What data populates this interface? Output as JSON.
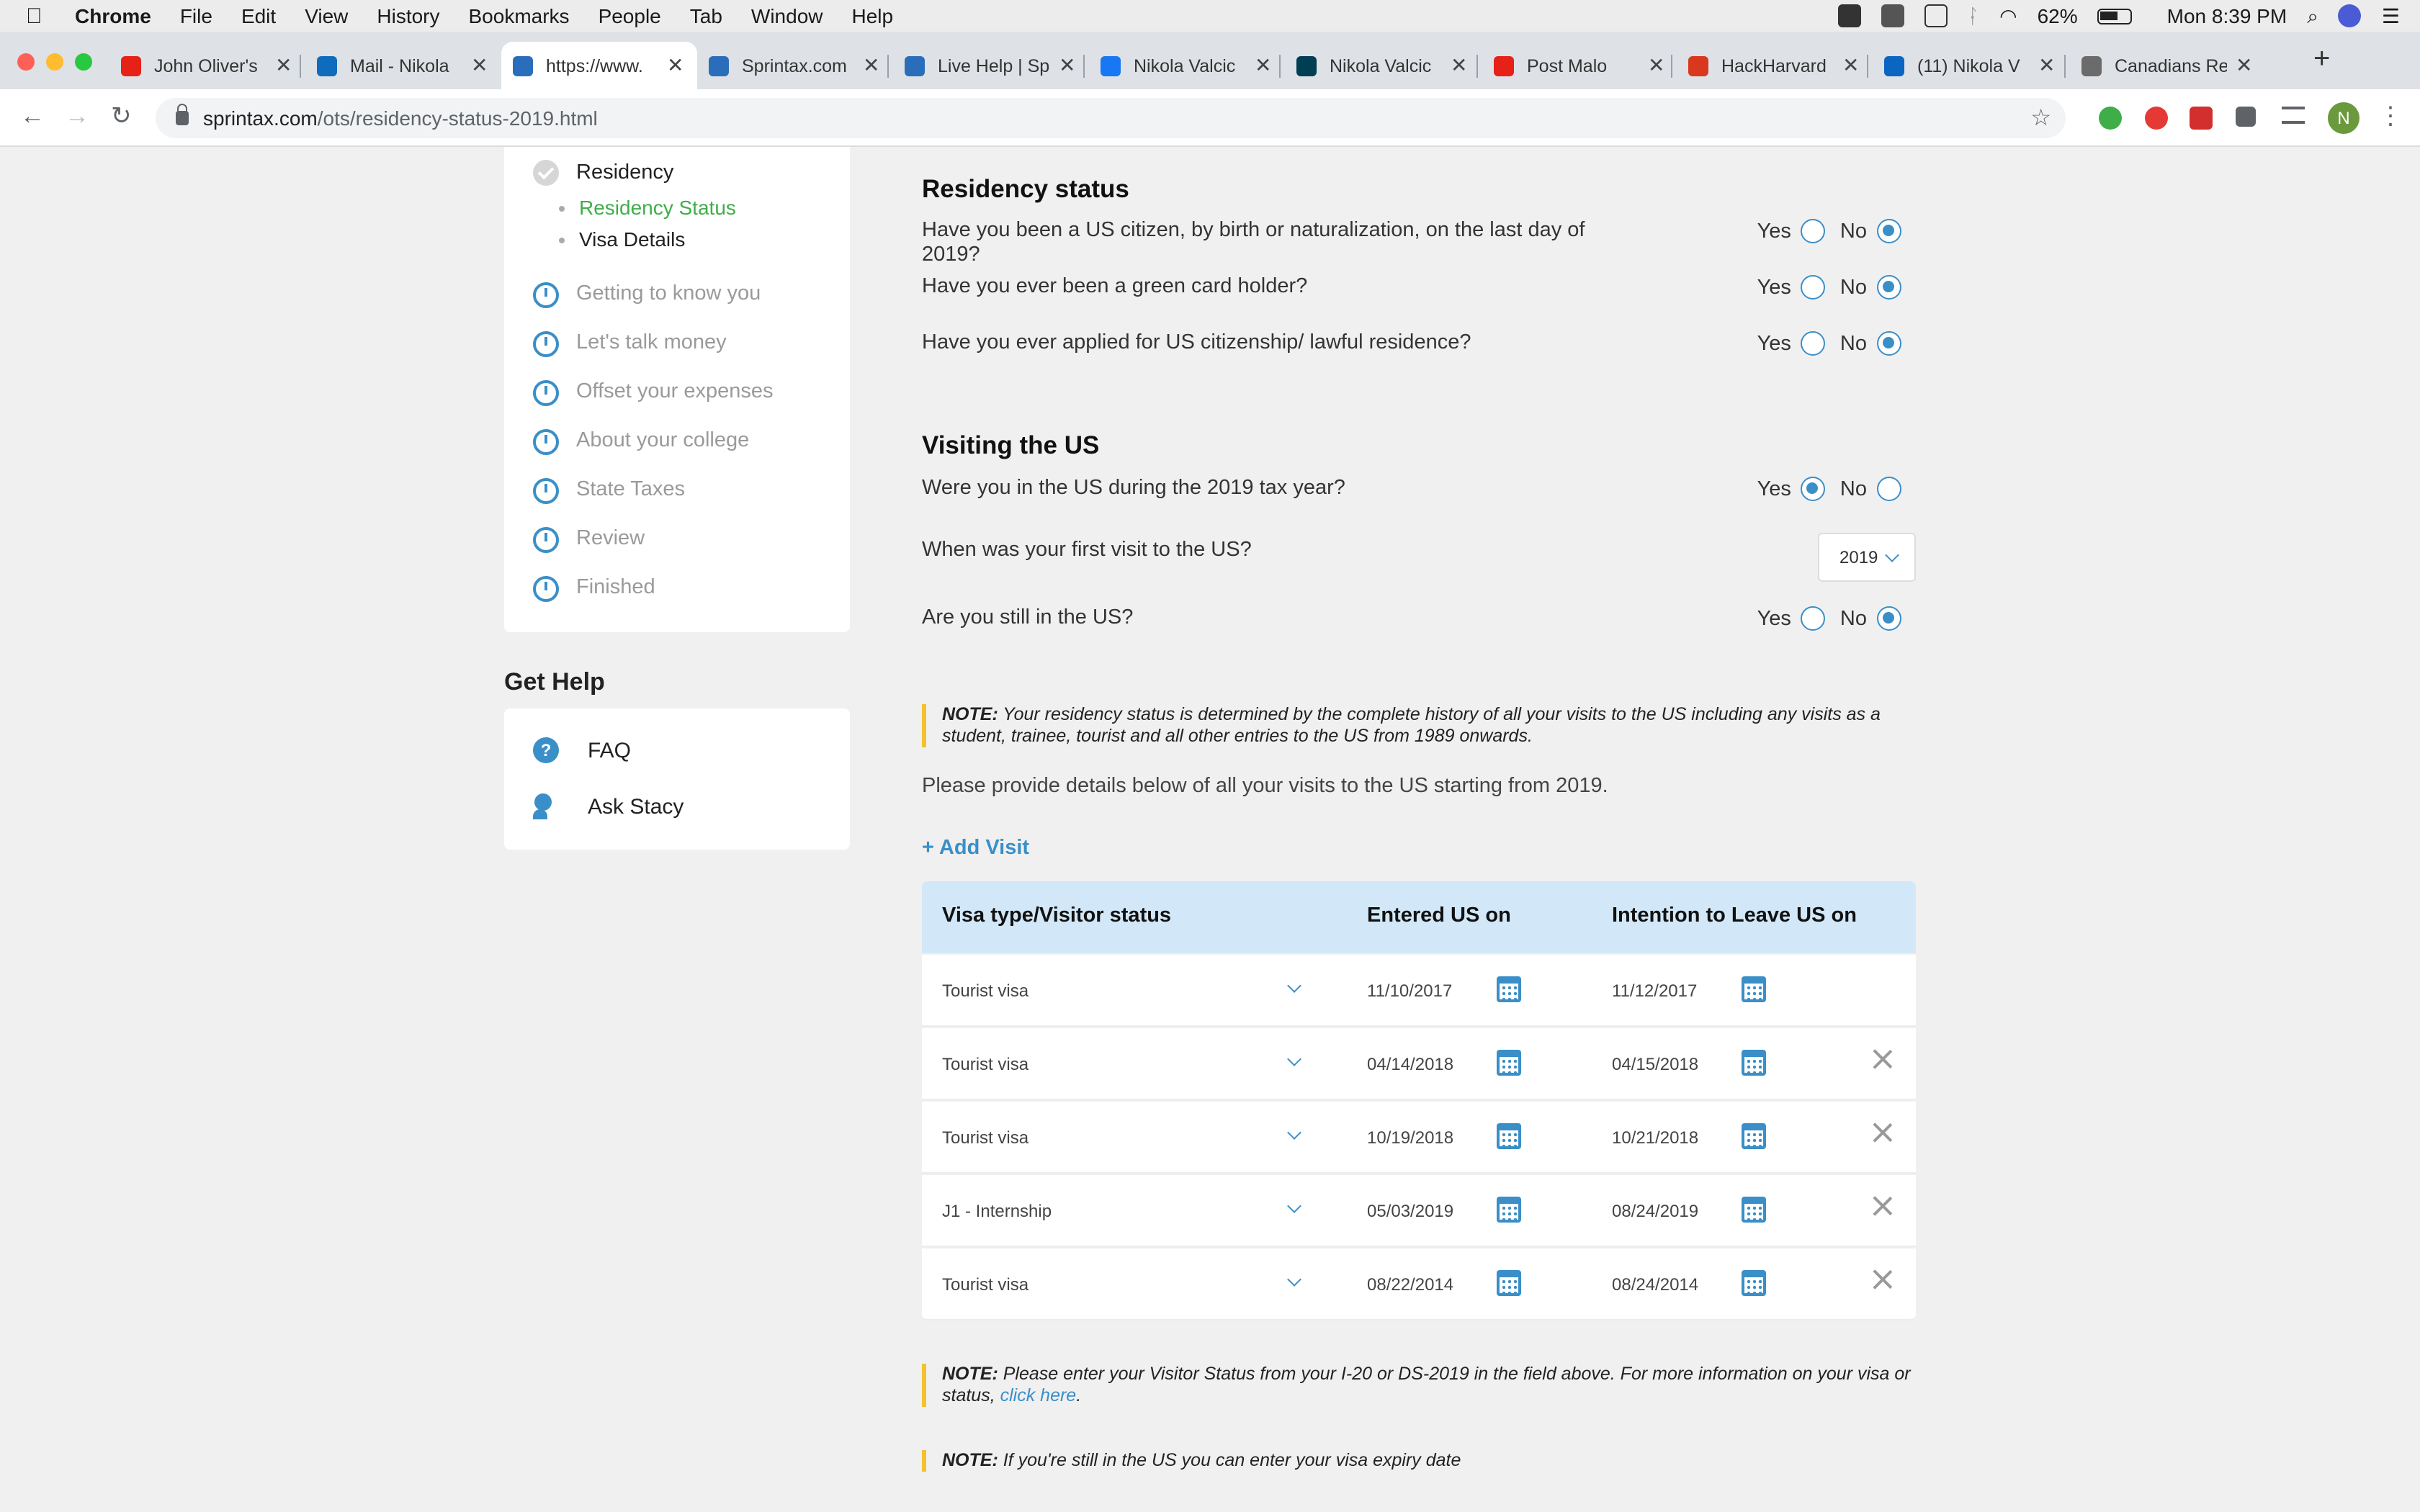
{
  "menubar": {
    "app": "Chrome",
    "items": [
      "File",
      "Edit",
      "View",
      "History",
      "Bookmarks",
      "People",
      "Tab",
      "Window",
      "Help"
    ],
    "battery": "62%",
    "clock": "Mon 8:39 PM"
  },
  "tabs": [
    {
      "label": "John Oliver's",
      "icon": "youtube-icon",
      "color": "#e62117"
    },
    {
      "label": "Mail - Nikola",
      "icon": "outlook-icon",
      "color": "#0f6cbd"
    },
    {
      "label": "https://www.",
      "icon": "sprintax-icon",
      "color": "#2a6ebb",
      "active": true
    },
    {
      "label": "Sprintax.com",
      "icon": "sprintax-icon",
      "color": "#2a6ebb"
    },
    {
      "label": "Live Help | Sp",
      "icon": "sprintax-icon",
      "color": "#2a6ebb"
    },
    {
      "label": "Nikola Valcic",
      "icon": "facebook-icon",
      "color": "#1877f2"
    },
    {
      "label": "Nikola Valcic",
      "icon": "devpost-icon",
      "color": "#003e54"
    },
    {
      "label": "Post Malo",
      "icon": "youtube-icon",
      "color": "#e62117"
    },
    {
      "label": "HackHarvard",
      "icon": "hackharvard-icon",
      "color": "#d9381e"
    },
    {
      "label": "(11) Nikola V",
      "icon": "linkedin-icon",
      "color": "#0a66c2"
    },
    {
      "label": "Canadians Re",
      "icon": "seal-icon",
      "color": "#6b6b6b"
    }
  ],
  "address": {
    "url_host": "sprintax.com",
    "url_path": "/ots/residency-status-2019.html"
  },
  "sidebar": {
    "section": "Residency",
    "sub_active": "Residency Status",
    "sub_next": "Visa Details",
    "steps": [
      "Getting to know you",
      "Let's talk money",
      "Offset your expenses",
      "About your college",
      "State Taxes",
      "Review",
      "Finished"
    ]
  },
  "help": {
    "title": "Get Help",
    "faq": "FAQ",
    "ask": "Ask Stacy"
  },
  "residency": {
    "title": "Residency status",
    "q1": "Have you been a US citizen, by birth or naturalization, on the last day of 2019?",
    "q2": "Have you ever been a green card holder?",
    "q3": "Have you ever applied for US citizenship/ lawful residence?",
    "yes": "Yes",
    "no": "No",
    "answers": [
      "No",
      "No",
      "No"
    ]
  },
  "visiting": {
    "title": "Visiting the US",
    "q1": "Were you in the US during the 2019 tax year?",
    "q2": "When was your first visit to the US?",
    "q2_value": "2019",
    "q3": "Are you still in the US?",
    "answers": [
      "Yes",
      "No"
    ]
  },
  "notes": {
    "label": "NOTE:",
    "n1": "Your residency status is determined by the complete history of all your visits to the US including any visits as a student, trainee, tourist and all other entries to the US from 1989 onwards.",
    "provide": "Please provide details below of all your visits to the US starting from 2019.",
    "add_visit": "+ Add Visit",
    "n2": "Please enter your Visitor Status from your I-20 or DS-2019 in the field above. For more information on your visa or status,",
    "n2_link": "click here",
    "n3": "If you're still in the US you can enter your visa expiry date"
  },
  "table": {
    "headers": [
      "Visa type/Visitor status",
      "Entered US on",
      "Intention to Leave US on"
    ],
    "rows": [
      {
        "type": "Tourist visa",
        "entered": "11/10/2017",
        "leave": "11/12/2017",
        "removable": false
      },
      {
        "type": "Tourist visa",
        "entered": "04/14/2018",
        "leave": "04/15/2018",
        "removable": true
      },
      {
        "type": "Tourist visa",
        "entered": "10/19/2018",
        "leave": "10/21/2018",
        "removable": true
      },
      {
        "type": "J1 - Internship",
        "entered": "05/03/2019",
        "leave": "08/24/2019",
        "removable": true
      },
      {
        "type": "Tourist visa",
        "entered": "08/22/2014",
        "leave": "08/24/2014",
        "removable": true
      }
    ]
  },
  "colors": {
    "accent": "#3a8fc8",
    "green": "#3fae49",
    "note_bar": "#f2c230",
    "table_header": "#d2e8f8"
  }
}
